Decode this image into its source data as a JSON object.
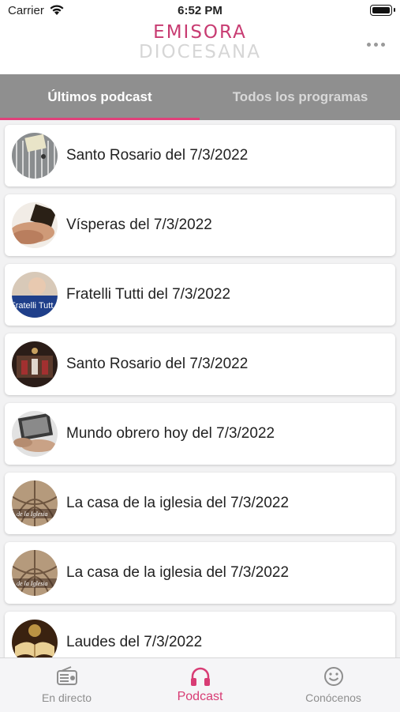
{
  "status_bar": {
    "carrier": "Carrier",
    "time": "6:52 PM"
  },
  "header": {
    "logo_line1": "EMISORA",
    "logo_line2": "DIOCESANA",
    "more_icon": "more-dots-icon"
  },
  "tabs": [
    {
      "label": "Últimos podcast",
      "active": true
    },
    {
      "label": "Todos los programas",
      "active": false
    }
  ],
  "podcasts": [
    {
      "title": "Santo Rosario del 7/3/2022",
      "thumbnail": "rosary-thumbnail"
    },
    {
      "title": "Vísperas del 7/3/2022",
      "thumbnail": "prayer-hands-thumbnail"
    },
    {
      "title": "Fratelli Tutti del 7/3/2022",
      "thumbnail": "pope-thumbnail",
      "thumbnail_text": "Fratelli Tutt"
    },
    {
      "title": "Santo Rosario del 7/3/2022",
      "thumbnail": "church-interior-thumbnail"
    },
    {
      "title": "Mundo obrero hoy del 7/3/2022",
      "thumbnail": "workers-thumbnail"
    },
    {
      "title": "La casa de la iglesia del 7/3/2022",
      "thumbnail": "vaulted-ceiling-thumbnail",
      "thumbnail_text": "de la Iglesia"
    },
    {
      "title": "La casa de la iglesia del 7/3/2022",
      "thumbnail": "vaulted-ceiling-thumbnail",
      "thumbnail_text": "de la Iglesia"
    },
    {
      "title": "Laudes del 7/3/2022",
      "thumbnail": "open-bible-thumbnail"
    }
  ],
  "tab_bar": [
    {
      "label": "En directo",
      "icon": "radio-icon",
      "active": false
    },
    {
      "label": "Podcast",
      "icon": "headphones-icon",
      "active": true
    },
    {
      "label": "Conócenos",
      "icon": "smiley-icon",
      "active": false
    }
  ],
  "colors": {
    "accent": "#d83c74",
    "logo_pink": "#c83c72",
    "tabs_bg": "#8f8f8f"
  }
}
